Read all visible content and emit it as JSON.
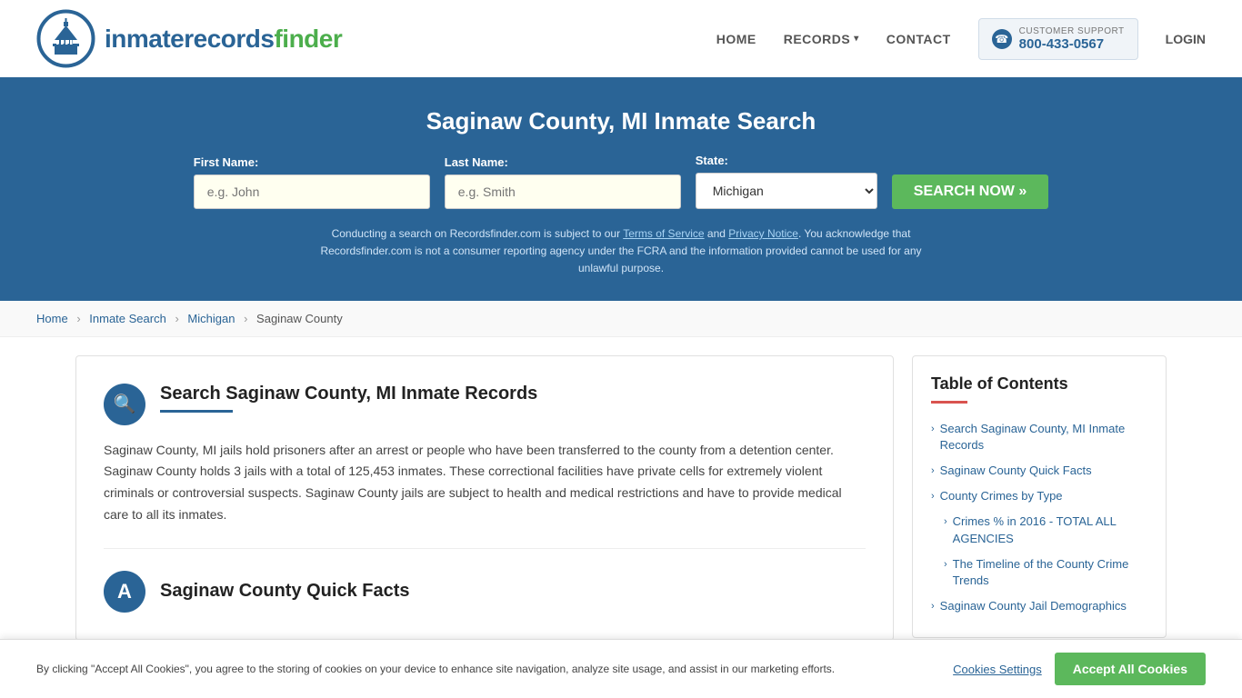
{
  "site": {
    "logo_text_main": "inmaterecords",
    "logo_text_bold": "finder"
  },
  "nav": {
    "home_label": "HOME",
    "records_label": "RECORDS",
    "contact_label": "CONTACT",
    "support_label": "CUSTOMER SUPPORT",
    "support_number": "800-433-0567",
    "login_label": "LOGIN"
  },
  "hero": {
    "title": "Saginaw County, MI Inmate Search",
    "first_name_label": "First Name:",
    "first_name_placeholder": "e.g. John",
    "last_name_label": "Last Name:",
    "last_name_placeholder": "e.g. Smith",
    "state_label": "State:",
    "state_value": "Michigan",
    "search_button": "SEARCH NOW »",
    "disclaimer": "Conducting a search on Recordsfinder.com is subject to our Terms of Service and Privacy Notice. You acknowledge that Recordsfinder.com is not a consumer reporting agency under the FCRA and the information provided cannot be used for any unlawful purpose.",
    "tos_text": "Terms of Service",
    "privacy_text": "Privacy Notice"
  },
  "breadcrumb": {
    "home": "Home",
    "inmate_search": "Inmate Search",
    "michigan": "Michigan",
    "current": "Saginaw County"
  },
  "content": {
    "section1": {
      "title": "Search Saginaw County, MI Inmate Records",
      "body": "Saginaw County, MI jails hold prisoners after an arrest or people who have been transferred to the county from a detention center. Saginaw County holds 3 jails with a total of 125,453 inmates. These correctional facilities have private cells for extremely violent criminals or controversial suspects. Saginaw County jails are subject to health and medical restrictions and have to provide medical care to all its inmates."
    },
    "section2": {
      "title": "Saginaw County Quick Facts"
    }
  },
  "toc": {
    "title": "Table of Contents",
    "items": [
      {
        "label": "Search Saginaw County, MI Inmate Records",
        "indent": false
      },
      {
        "label": "Saginaw County Quick Facts",
        "indent": false
      },
      {
        "label": "County Crimes by Type",
        "indent": false
      },
      {
        "label": "Crimes % in 2016 - TOTAL ALL AGENCIES",
        "indent": true
      },
      {
        "label": "The Timeline of the County Crime Trends",
        "indent": true
      },
      {
        "label": "Saginaw County Jail Demographics",
        "indent": false
      }
    ]
  },
  "cookie_banner": {
    "text": "By clicking \"Accept All Cookies\", you agree to the storing of cookies on your device to enhance site navigation, analyze site usage, and assist in our marketing efforts.",
    "settings_label": "Cookies Settings",
    "accept_label": "Accept All Cookies"
  },
  "icons": {
    "search": "🔍",
    "magnify": "🔎",
    "chevron_right": "›",
    "chevron_down": "▾",
    "phone": "☎",
    "info": "ℹ",
    "arrow": "A"
  }
}
